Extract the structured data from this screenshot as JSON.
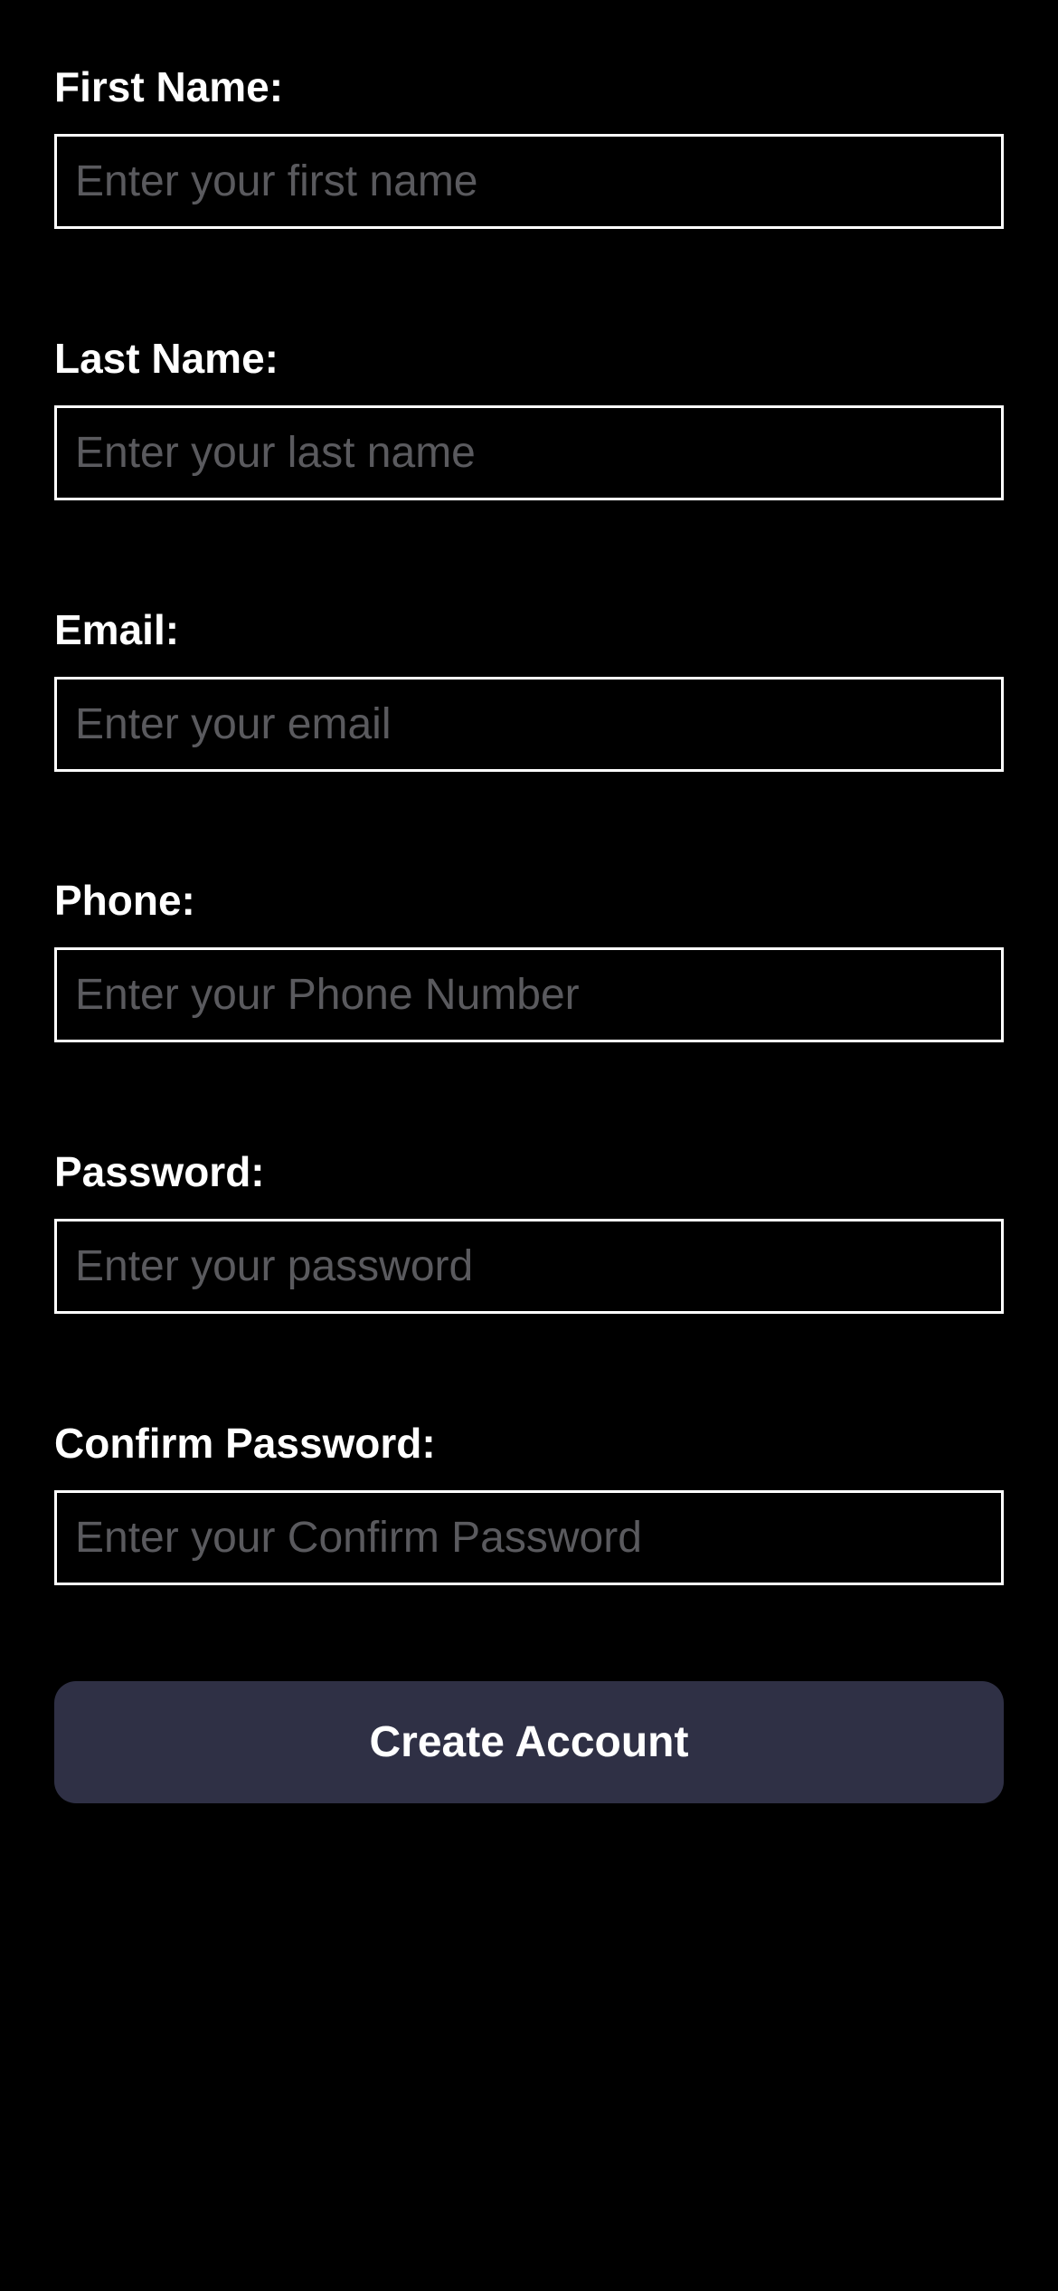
{
  "form": {
    "fields": [
      {
        "label": "First Name:",
        "placeholder": "Enter your first name",
        "value": ""
      },
      {
        "label": "Last Name:",
        "placeholder": "Enter your last name",
        "value": ""
      },
      {
        "label": "Email:",
        "placeholder": "Enter your email",
        "value": ""
      },
      {
        "label": "Phone:",
        "placeholder": "Enter your Phone Number",
        "value": ""
      },
      {
        "label": "Password:",
        "placeholder": "Enter your password",
        "value": ""
      },
      {
        "label": "Confirm Password:",
        "placeholder": "Enter your Confirm Password",
        "value": ""
      }
    ],
    "submit_label": "Create Account"
  },
  "colors": {
    "background": "#000000",
    "text": "#ffffff",
    "input_border": "#ffffff",
    "placeholder": "#5a5a5e",
    "button_background": "#2f3045"
  }
}
